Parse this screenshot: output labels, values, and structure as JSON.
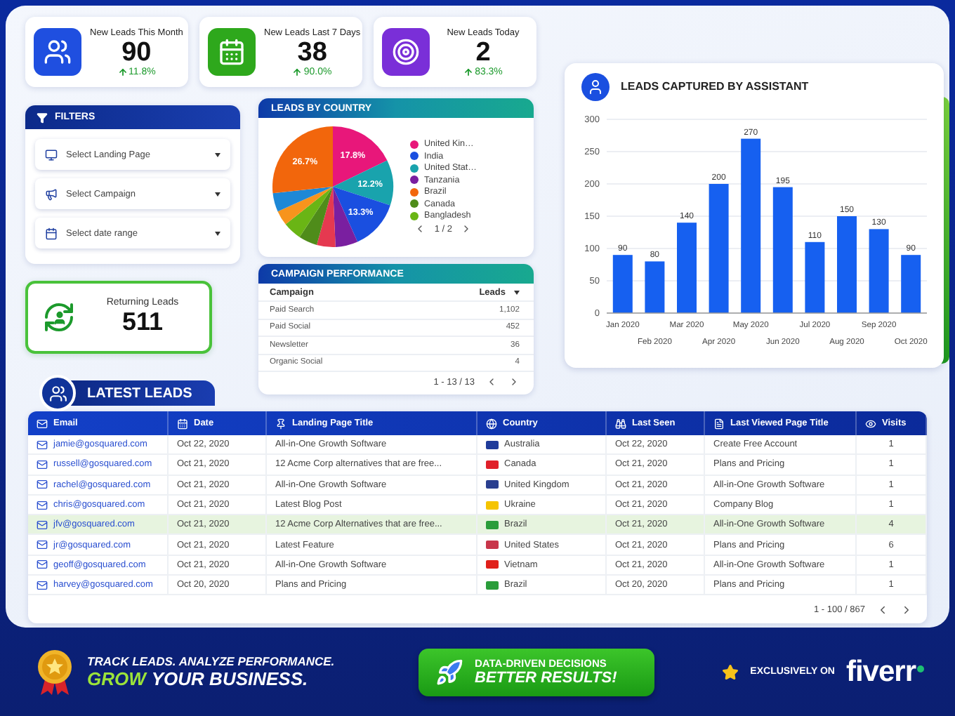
{
  "kpis": [
    {
      "label": "New Leads This Month",
      "value": "90",
      "change": "11.8%",
      "color": "#1f4fe0"
    },
    {
      "label": "New Leads Last 7 Days",
      "value": "38",
      "change": "90.0%",
      "color": "#2ea81c"
    },
    {
      "label": "New Leads Today",
      "value": "2",
      "change": "83.3%",
      "color": "#7a2fd8"
    }
  ],
  "filters": {
    "title": "FILTERS",
    "dropdowns": [
      {
        "placeholder": "Select Landing Page"
      },
      {
        "placeholder": "Select Campaign"
      },
      {
        "placeholder": "Select date range"
      }
    ]
  },
  "returning_leads": {
    "label": "Returning Leads",
    "value": "511"
  },
  "leads_by_country": {
    "title": "LEADS BY COUNTRY",
    "slice_labels": [
      "17.8%",
      "12.2%",
      "13.3%",
      "26.7%"
    ],
    "legend": [
      {
        "name": "United Kin…",
        "color": "#e8177a"
      },
      {
        "name": "India",
        "color": "#1a4fe0"
      },
      {
        "name": "United Stat…",
        "color": "#19a3ad"
      },
      {
        "name": "Tanzania",
        "color": "#7a1fa0"
      },
      {
        "name": "Brazil",
        "color": "#f2660c"
      },
      {
        "name": "Canada",
        "color": "#4f8c1a"
      },
      {
        "name": "Bangladesh",
        "color": "#6ab515"
      }
    ],
    "page": "1 / 2"
  },
  "campaign_performance": {
    "title": "CAMPAIGN PERFORMANCE",
    "columns": [
      "Campaign",
      "Leads"
    ],
    "rows": [
      {
        "campaign": "Paid Search",
        "leads": "1,102"
      },
      {
        "campaign": "Paid Social",
        "leads": "452"
      },
      {
        "campaign": "Newsletter",
        "leads": "36"
      },
      {
        "campaign": "Organic Social",
        "leads": "4"
      }
    ],
    "pagination": "1 - 13 / 13"
  },
  "leads_captured": {
    "chart_data": {
      "type": "bar",
      "title": "LEADS CAPTURED BY ASSISTANT",
      "categories": [
        "Jan 2020",
        "Feb 2020",
        "Mar 2020",
        "Apr 2020",
        "May 2020",
        "Jun 2020",
        "Jul 2020",
        "Aug 2020",
        "Sep 2020",
        "Oct 2020"
      ],
      "values": [
        90,
        80,
        140,
        200,
        270,
        195,
        110,
        150,
        130,
        90
      ],
      "ylim": [
        0,
        300
      ],
      "yticks": [
        0,
        50,
        100,
        150,
        200,
        250,
        300
      ],
      "grid": true,
      "data_labels": true
    }
  },
  "latest_leads": {
    "title": "LATEST LEADS",
    "columns": [
      "Email",
      "Date",
      "Landing Page Title",
      "Country",
      "Last Seen",
      "Last Viewed Page Title",
      "Visits"
    ],
    "rows": [
      {
        "email": "jamie@gosquared.com",
        "date": "Oct 22, 2020",
        "landing": "All-in-One Growth Software",
        "country": {
          "name": "Australia",
          "color": "#1f3b9a"
        },
        "last_seen": "Oct 22, 2020",
        "last_page": "Create Free Account",
        "visits": "1",
        "selected": false
      },
      {
        "email": "russell@gosquared.com",
        "date": "Oct 21, 2020",
        "landing": "12 Acme Corp alternatives that are free...",
        "country": {
          "name": "Canada",
          "color": "#e0202a"
        },
        "last_seen": "Oct 21, 2020",
        "last_page": "Plans and Pricing",
        "visits": "1",
        "selected": false
      },
      {
        "email": "rachel@gosquared.com",
        "date": "Oct 21, 2020",
        "landing": "All-in-One Growth Software",
        "country": {
          "name": "United Kingdom",
          "color": "#2a3f8f"
        },
        "last_seen": "Oct 21, 2020",
        "last_page": "All-in-One Growth Software",
        "visits": "1",
        "selected": false
      },
      {
        "email": "chris@gosquared.com",
        "date": "Oct 21, 2020",
        "landing": "Latest Blog Post",
        "country": {
          "name": "Ukraine",
          "color": "#f5c400"
        },
        "last_seen": "Oct 21, 2020",
        "last_page": "Company Blog",
        "visits": "1",
        "selected": false
      },
      {
        "email": "jfv@gosquared.com",
        "date": "Oct 21, 2020",
        "landing": "12 Acme Corp Alternatives that are free...",
        "country": {
          "name": "Brazil",
          "color": "#2a9d3a"
        },
        "last_seen": "Oct 21, 2020",
        "last_page": "All-in-One Growth Software",
        "visits": "4",
        "selected": true
      },
      {
        "email": "jr@gosquared.com",
        "date": "Oct 21, 2020",
        "landing": "Latest Feature",
        "country": {
          "name": "United States",
          "color": "#c8364a"
        },
        "last_seen": "Oct 21, 2020",
        "last_page": "Plans and Pricing",
        "visits": "6",
        "selected": false
      },
      {
        "email": "geoff@gosquared.com",
        "date": "Oct 21, 2020",
        "landing": "All-in-One Growth Software",
        "country": {
          "name": "Vietnam",
          "color": "#e0201a"
        },
        "last_seen": "Oct 21, 2020",
        "last_page": "All-in-One Growth Software",
        "visits": "1",
        "selected": false
      },
      {
        "email": "harvey@gosquared.com",
        "date": "Oct 20, 2020",
        "landing": "Plans and Pricing",
        "country": {
          "name": "Brazil",
          "color": "#2a9d3a"
        },
        "last_seen": "Oct 20, 2020",
        "last_page": "Plans and Pricing",
        "visits": "1",
        "selected": false
      }
    ],
    "pagination": "1 - 100 / 867"
  },
  "banner": {
    "tagline": "TRACK LEADS. ANALYZE PERFORMANCE.",
    "highlight": "GROW",
    "tagline_end": "YOUR BUSINESS.",
    "cta": [
      "DATA-DRIVEN DECISIONS",
      "BETTER RESULTS!"
    ],
    "exclusive": "EXCLUSIVELY ON",
    "logo": "fiverr"
  }
}
